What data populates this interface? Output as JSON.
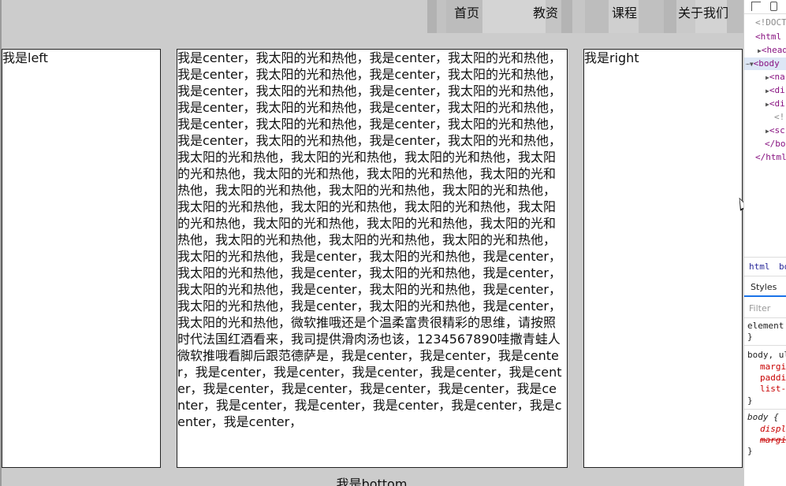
{
  "nav": {
    "items": [
      "首页",
      "教资",
      "课程",
      "关于我们"
    ]
  },
  "columns": {
    "left": "我是left",
    "center": "我是center，我太阳的光和热他，我是center，我太阳的光和热他，我是center，我太阳的光和热他，我是center，我太阳的光和热他，我是center，我太阳的光和热他，我是center，我太阳的光和热他，我是center，我太阳的光和热他，我是center，我太阳的光和热他，我是center，我太阳的光和热他，我是center，我太阳的光和热他，我是center，我太阳的光和热他，我是center，我太阳的光和热他，我太阳的光和热他，我太阳的光和热他，我太阳的光和热他，我太阳的光和热他，我太阳的光和热他，我太阳的光和热他，我太阳的光和热他，我太阳的光和热他，我太阳的光和热他，我太阳的光和热他，我太阳的光和热他，我太阳的光和热他，我太阳的光和热他，我太阳的光和热他，我太阳的光和热他，我太阳的光和热他，我太阳的光和热他，我太阳的光和热他，我太阳的光和热他，我太阳的光和热他，我太阳的光和热他，我是center，我太阳的光和热他，我是center，我太阳的光和热他，我是center，我太阳的光和热他，我是center，我太阳的光和热他，我是center，我太阳的光和热他，我是center，我太阳的光和热他，我是center，我太阳的光和热他，我是center，我太阳的光和热他，微软推哦还是个温柔富贵很精彩的思维，请按照时代法国红酒看来，我司提供滑肉汤也该，1234567890哇撒青蛙人微软推哦看脚后跟范德萨是，我是center，我是center，我是center，我是center，我是center，我是center，我是center，我是center，我是center，我是center，我是center，我是center，我是center，我是center，我是center，我是center，我是center，我是center，我是center，",
    "right": "我是right",
    "bottom": "我是bottom"
  },
  "devtools": {
    "dom": [
      "<!DOCT",
      "<html",
      "<head",
      "<body",
      "<na",
      "<di",
      "<di",
      "<!-",
      "<sc",
      "</bo",
      "</html"
    ],
    "crumbs": [
      "html",
      "bo"
    ],
    "styles_tab": "Styles",
    "filter_placeholder": "Filter",
    "rule1_selector": "element.",
    "rule1_close": "}",
    "rule2_selector": "body, ul",
    "rule2_props": [
      "margi",
      "paddi",
      "list-"
    ],
    "rule2_close": "}",
    "rule3_selector": "body {",
    "rule3_props": [
      "displ",
      "margi"
    ],
    "rule3_close": "}"
  }
}
